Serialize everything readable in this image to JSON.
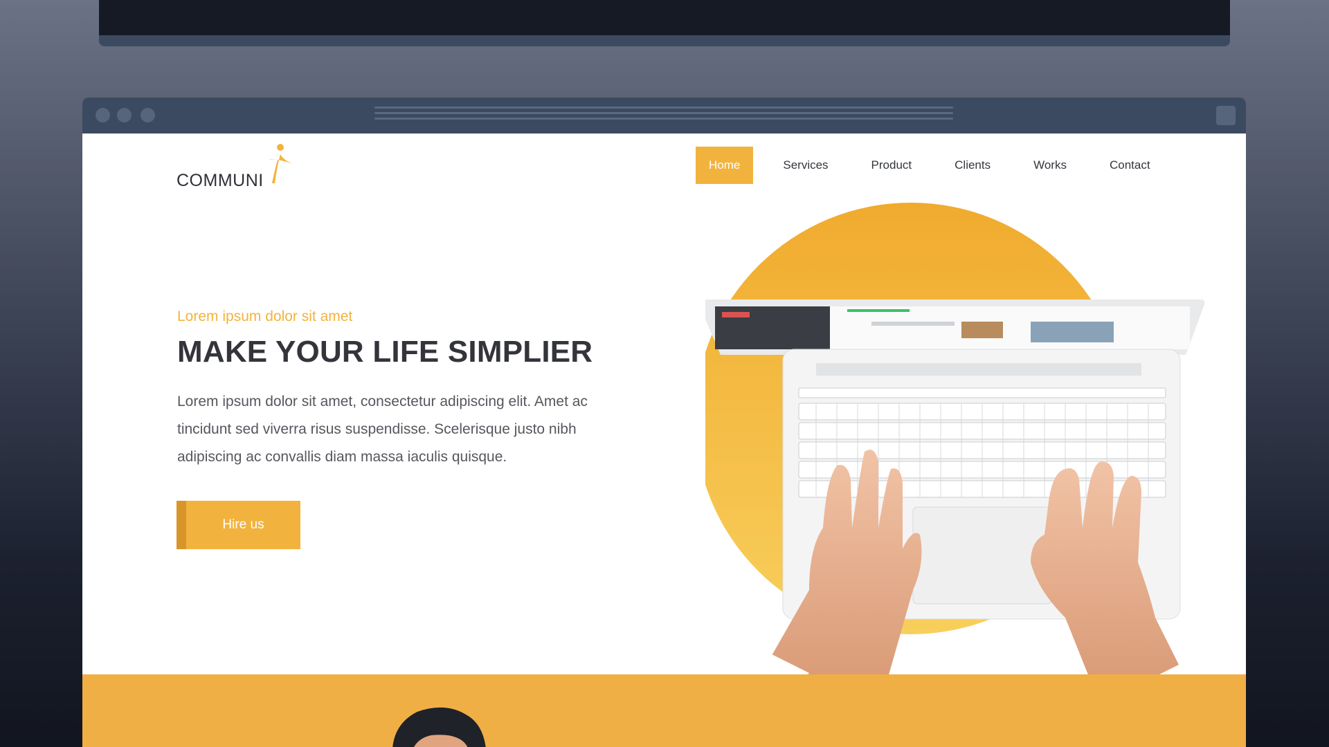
{
  "brand": {
    "logo_text": "COMMUNI",
    "accent_color": "#f2b33e"
  },
  "nav": {
    "items": [
      {
        "label": "Home",
        "active": true
      },
      {
        "label": "Services",
        "active": false
      },
      {
        "label": "Product",
        "active": false
      },
      {
        "label": "Clients",
        "active": false
      },
      {
        "label": "Works",
        "active": false
      },
      {
        "label": "Contact",
        "active": false
      }
    ]
  },
  "hero": {
    "kicker": "Lorem ipsum dolor sit amet",
    "title": "MAKE YOUR LIFE SIMPLIER",
    "body_lines": [
      "Lorem ipsum dolor sit amet, consectetur adipiscing elit. Amet ac",
      "tincidunt sed viverra risus suspendisse. Scelerisque justo nibh",
      "adipiscing ac convallis diam massa iaculis quisque."
    ],
    "cta_label": "Hire us"
  },
  "icons": {
    "logo": "person-figure-logo-icon",
    "hero_image": "laptop-typing-hands-image",
    "band_image": "person-portrait-image"
  }
}
